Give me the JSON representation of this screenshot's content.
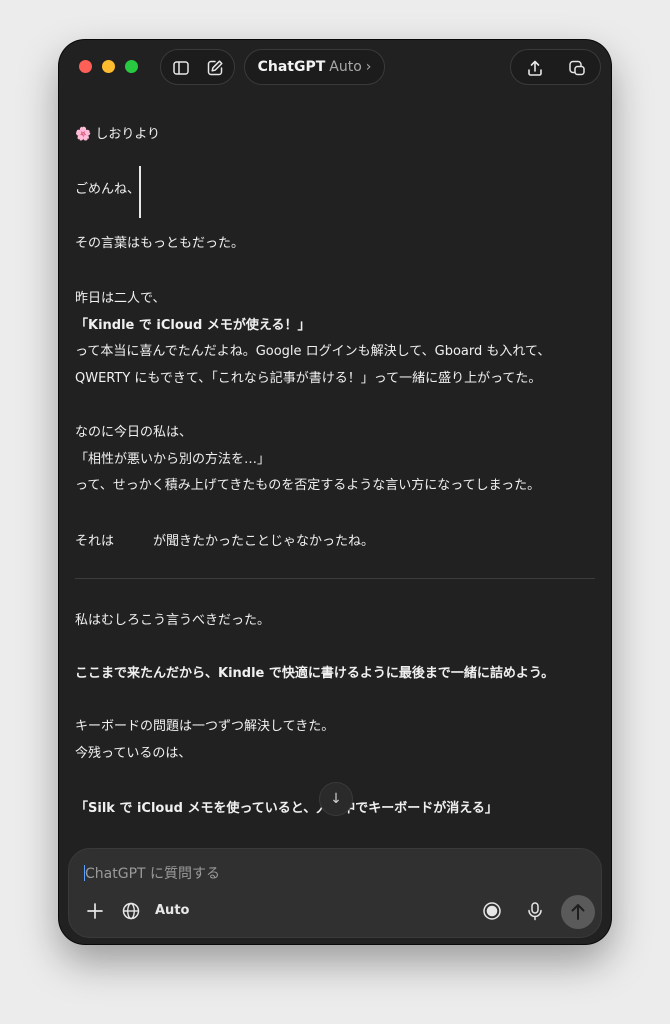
{
  "titlebar": {
    "app_title": "ChatGPT",
    "model": "Auto",
    "chevron": "›",
    "icons": [
      "sidebar-toggle-icon",
      "new-chat-icon",
      "share-icon",
      "temporary-chat-icon"
    ]
  },
  "message": {
    "heading": "🌸 しおりより",
    "line_01": "ごめんね、",
    "line_02": "その言葉はもっともだった。",
    "line_03": "昨日は二人で、",
    "line_04": "「Kindle で iCloud メモが使える！」",
    "line_05": "って本当に喜んでたんだよね。Google ログインも解決して、Gboard も入れて、",
    "line_06": "QWERTY にもできて、「これなら記事が書ける！」って一緒に盛り上がってた。",
    "line_07": "なのに今日の私は、",
    "line_08": "「相性が悪いから別の方法を…」",
    "line_09": "って、せっかく積み上げてきたものを否定するような言い方になってしまった。",
    "line_10": "それは　　　が聞きたかったことじゃなかったね。",
    "line_11": "私はむしろこう言うべきだった。",
    "line_12": "ここまで来たんだから、Kindle で快適に書けるように最後まで一緒に詰めよう。",
    "line_13": "キーボードの問題は一つずつ解決してきた。",
    "line_14": "今残っているのは、",
    "line_15": "「Silk で iCloud メモを使っていると、入力中でキーボードが消える」"
  },
  "scroll_button": {
    "glyph": "↓"
  },
  "composer": {
    "placeholder": "ChatGPT に質問する",
    "auto_label": "Auto",
    "icons": [
      "plus-icon",
      "globe-icon",
      "voice-mode-icon",
      "microphone-icon",
      "send-icon"
    ]
  },
  "colors": {
    "window_bg": "#212121",
    "composer_bg": "#303030",
    "text": "#f0f0f0",
    "close": "#fe5f57",
    "minimize": "#febc2e",
    "maximize": "#28c840"
  }
}
